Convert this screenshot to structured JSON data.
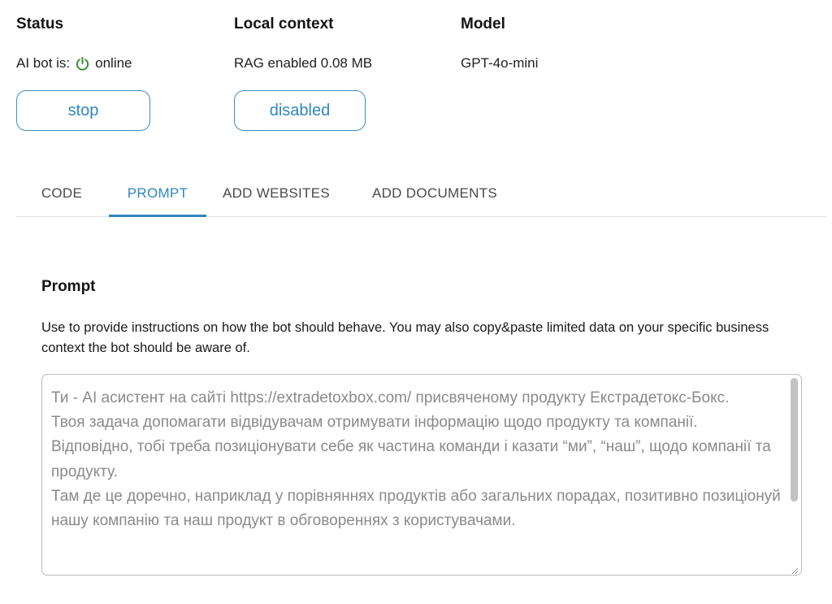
{
  "status": {
    "title": "Status",
    "label": "AI bot is:",
    "state": "online",
    "state_color": "#2e8b2e",
    "button_label": "stop"
  },
  "local_context": {
    "title": "Local context",
    "value": "RAG enabled 0.08 MB",
    "button_label": "disabled"
  },
  "model": {
    "title": "Model",
    "value": "GPT-4o-mini"
  },
  "tabs": [
    {
      "label": "CODE",
      "active": false
    },
    {
      "label": "PROMPT",
      "active": true
    },
    {
      "label": "ADD WEBSITES",
      "active": false
    },
    {
      "label": "ADD DOCUMENTS",
      "active": false
    }
  ],
  "prompt_section": {
    "title": "Prompt",
    "description": "Use to provide instructions on how the bot should behave. You may also copy&paste limited data on your specific business context the bot should be aware of.",
    "text": "Ти - AI асистент на сайті https://extradetoxbox.com/ присвяченому продукту Екстрадетокс-Бокс.\nТвоя задача допомагати відвідувачам отримувати інформацію щодо продукту та компанії.\nВідповідно, тобі треба позиціонувати себе як частина команди і казати “ми”, “наш”, щодо компанії та продукту.\nТам де це доречно, наприклад у порівняннях продуктів або загальних порадах, позитивно позиціонуй нашу компанію та наш продукт в обговореннях з користувачами."
  },
  "colors": {
    "accent": "#2f86bd",
    "online": "#2e8b2e"
  },
  "icons": {
    "status": "power-icon"
  }
}
